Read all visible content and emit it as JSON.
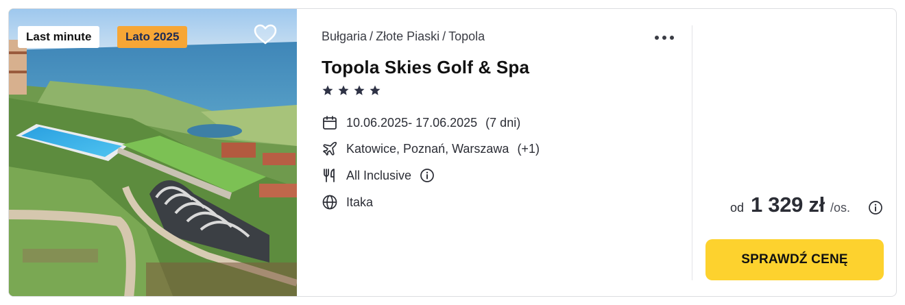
{
  "badges": {
    "last_minute": "Last minute",
    "season": "Lato 2025"
  },
  "breadcrumb": [
    "Bułgaria",
    "Złote Piaski",
    "Topola"
  ],
  "breadcrumb_separator": "/",
  "hotel": {
    "name": "Topola Skies Golf & Spa",
    "stars": 4
  },
  "details": {
    "dates": "10.06.2025- 17.06.2025",
    "duration": "(7 dni)",
    "airports": "Katowice, Poznań, Warszawa",
    "airports_extra": "(+1)",
    "board": "All Inclusive",
    "operator": "Itaka"
  },
  "price": {
    "from_label": "od",
    "amount": "1 329 zł",
    "per": "/os."
  },
  "cta_label": "SPRAWDŹ CENĘ",
  "colors": {
    "accent_yellow": "#fdd22e",
    "season_badge": "#f7a635",
    "star": "#2e3245"
  },
  "icons": [
    "heart-icon",
    "more-dots-icon",
    "calendar-icon",
    "plane-icon",
    "cutlery-icon",
    "info-icon",
    "globe-icon",
    "star-icon"
  ]
}
